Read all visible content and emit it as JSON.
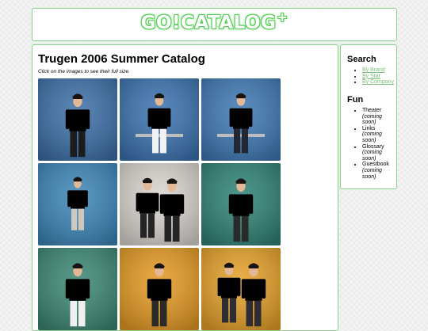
{
  "header": {
    "logo_text": "GO!CATALOG",
    "logo_plus": "+"
  },
  "main": {
    "title": "Trugen 2006 Summer Catalog",
    "hint": "Click on the images to see their full size.",
    "images": [
      {
        "name": "catalog-photo-1",
        "bg": "#3c6fa8",
        "top": "#1c1c1c",
        "pants": "#1c1c1c",
        "pose": "stand"
      },
      {
        "name": "catalog-photo-2",
        "bg": "#3a72b0",
        "top": "#2a2a2a",
        "pants": "#f2f2f2",
        "pose": "sit"
      },
      {
        "name": "catalog-photo-3",
        "bg": "#3d78b4",
        "top": "#c0332e",
        "pants": "#222733",
        "pose": "sit"
      },
      {
        "name": "catalog-photo-4",
        "bg": "#3c85b8",
        "top": "#2b2b33",
        "pants": "#cfc8bc",
        "pose": "crouch"
      },
      {
        "name": "catalog-photo-5",
        "bg": "#d9d4cf",
        "top": "#6e3f86",
        "pants": "#242424",
        "pose": "pair"
      },
      {
        "name": "catalog-photo-6",
        "bg": "#2f8275",
        "top": "#9a9a9a",
        "pants": "#2a2a2a",
        "pose": "lean"
      },
      {
        "name": "catalog-photo-7",
        "bg": "#3b8773",
        "top": "#f0f0f0",
        "pants": "#f0f0f0",
        "pose": "stand"
      },
      {
        "name": "catalog-photo-8",
        "bg": "#e59a22",
        "top": "#7e7e7e",
        "pants": "#2a2a2a",
        "pose": "stand"
      },
      {
        "name": "catalog-photo-9",
        "bg": "#e6a128",
        "top": "#2d2d33",
        "pants": "#2d2d33",
        "pose": "pair"
      }
    ]
  },
  "sidebar": {
    "search_heading": "Search",
    "search_links": [
      {
        "label": "By Brand"
      },
      {
        "label": "By Star"
      },
      {
        "label": "By Company"
      }
    ],
    "fun_heading": "Fun",
    "fun_items": [
      {
        "label": "Theater",
        "note": "(coming soon)"
      },
      {
        "label": "Links",
        "note": "(coming soon)"
      },
      {
        "label": "Glossary",
        "note": "(coming soon)"
      },
      {
        "label": "Guestbook",
        "note": "(coming soon)"
      }
    ]
  }
}
